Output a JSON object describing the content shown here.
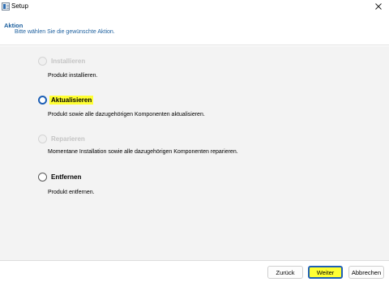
{
  "window": {
    "title": "Setup"
  },
  "header": {
    "title": "Aktion",
    "subtitle": "Bitte wählen Sie die gewünschte Aktion."
  },
  "options": [
    {
      "label": "Installieren",
      "description": "Produkt installieren.",
      "state": "disabled"
    },
    {
      "label": "Aktualisieren",
      "description": "Produkt sowie alle dazugehörigen Komponenten aktualisieren.",
      "state": "selected"
    },
    {
      "label": "Reparieren",
      "description": "Momentane Installation sowie alle dazugehörigen Komponenten reparieren.",
      "state": "disabled"
    },
    {
      "label": "Entfernen",
      "description": "Produkt entfernen.",
      "state": "enabled"
    }
  ],
  "buttons": {
    "back": "Zurück",
    "next": "Weiter",
    "cancel": "Abbrechen"
  },
  "colors": {
    "accent": "#1d5fb5",
    "header_text": "#1c5f9e",
    "highlight": "#ffff33",
    "content_bg": "#f3f3f3"
  },
  "icons": {
    "app": "setup-app-icon",
    "close": "close-icon"
  }
}
